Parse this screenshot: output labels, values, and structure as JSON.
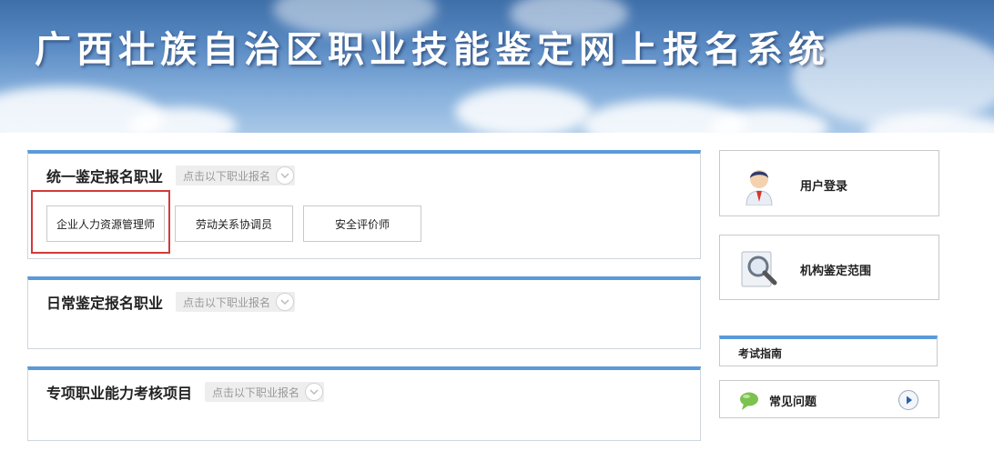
{
  "banner": {
    "title": "广西壮族自治区职业技能鉴定网上报名系统"
  },
  "panels": [
    {
      "title": "统一鉴定报名职业",
      "hint": "点击以下职业报名",
      "jobs": [
        "企业人力资源管理师",
        "劳动关系协调员",
        "安全评价师"
      ]
    },
    {
      "title": "日常鉴定报名职业",
      "hint": "点击以下职业报名"
    },
    {
      "title": "专项职业能力考核项目",
      "hint": "点击以下职业报名"
    }
  ],
  "sidebar": {
    "login_label": "用户登录",
    "scope_label": "机构鉴定范围",
    "guide_title": "考试指南",
    "faq_label": "常见问题"
  },
  "colors": {
    "accent_blue": "#5a9ad9",
    "highlight_red": "#d23a3a"
  }
}
